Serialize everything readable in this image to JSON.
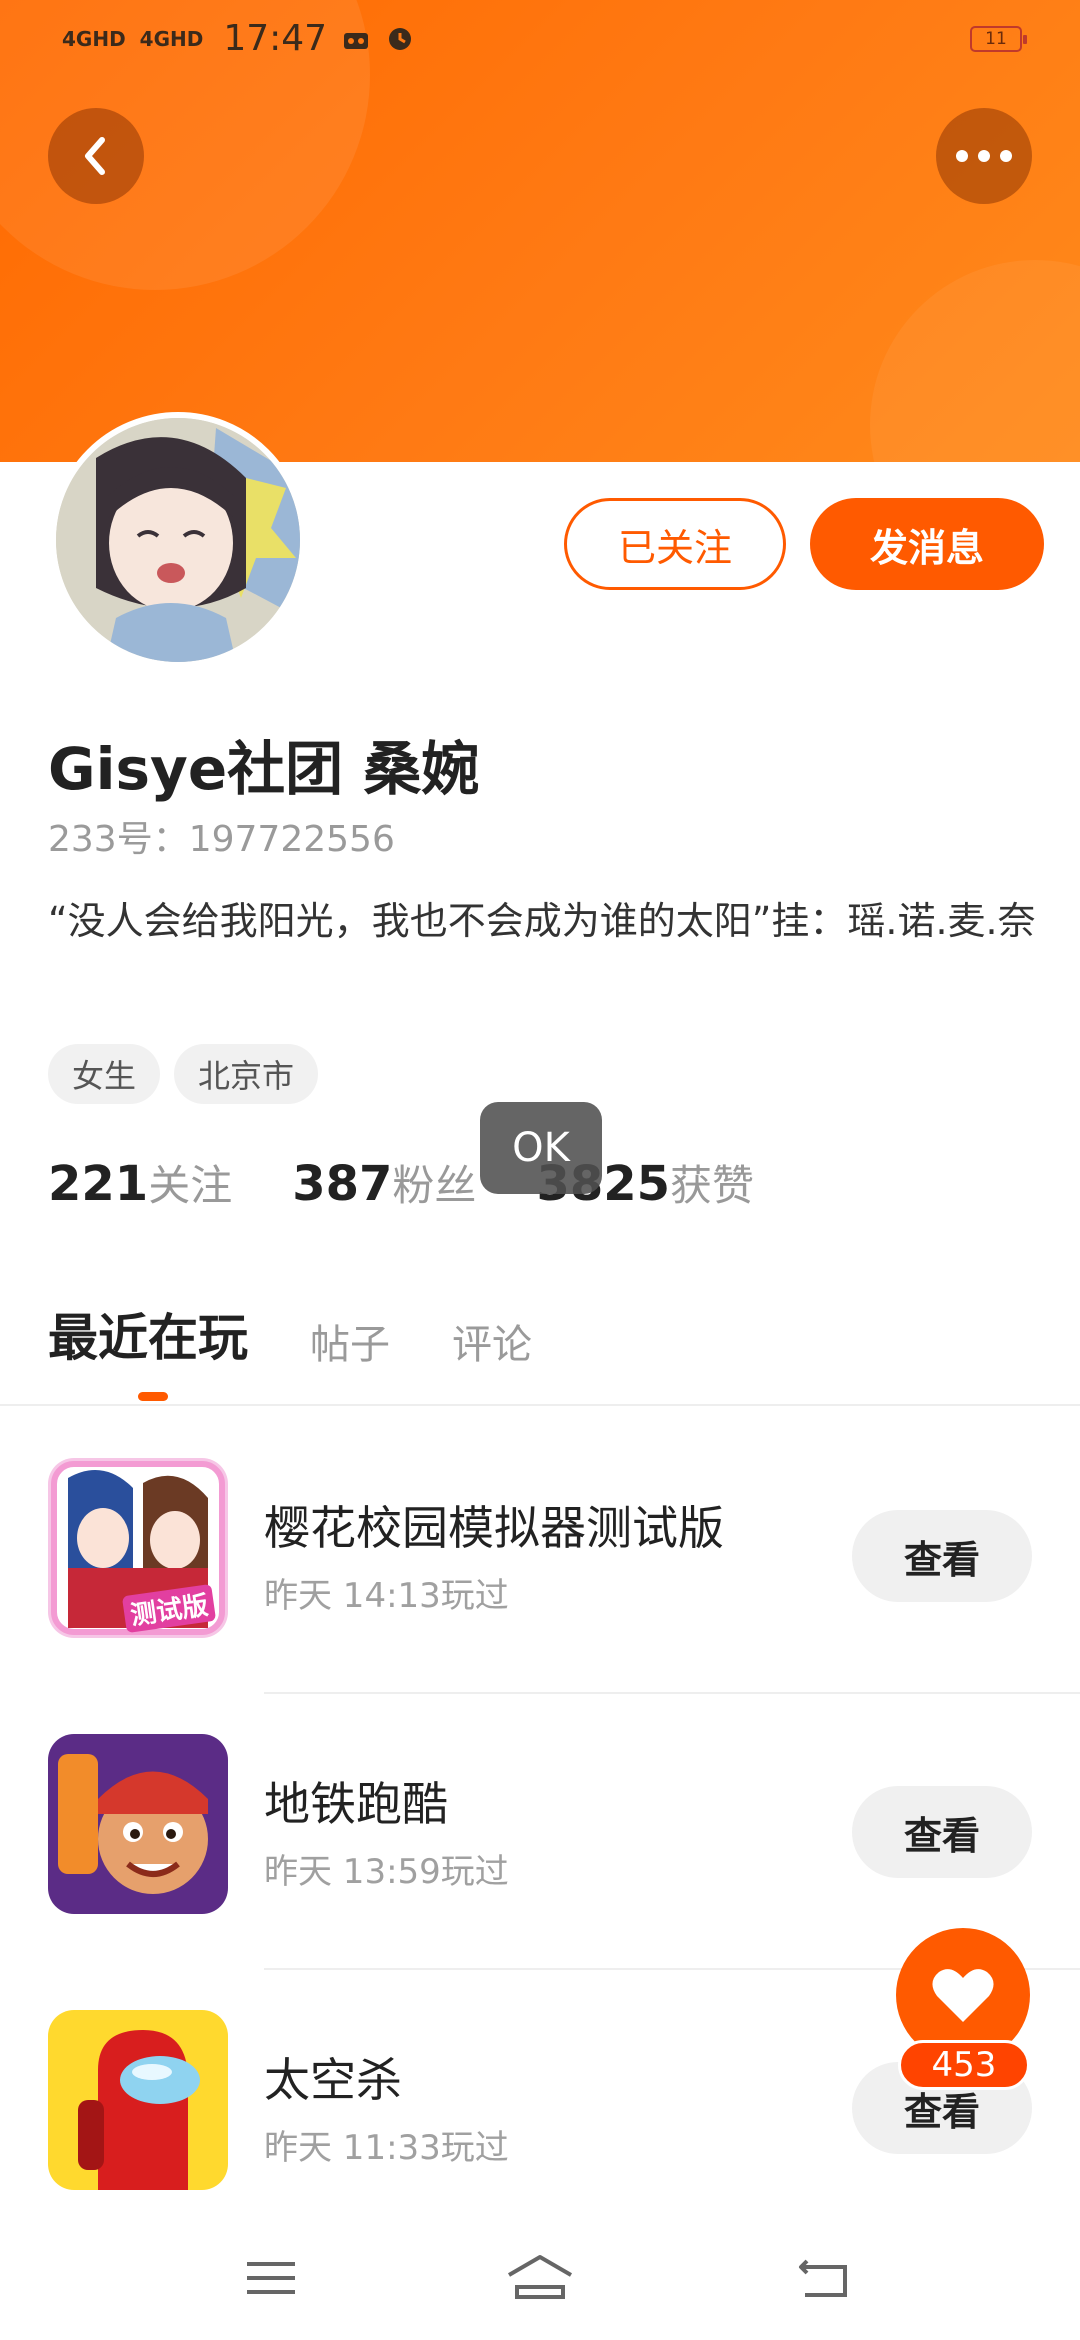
{
  "status_bar": {
    "network1": "4GHD",
    "network2": "4GHD",
    "time": "17:47",
    "battery": "11"
  },
  "colors": {
    "accent": "#ff5a00",
    "banner": "#ff6a00"
  },
  "icons": {
    "back": "chevron-left-icon",
    "more": "more-dots-icon",
    "like": "heart-icon",
    "nav_menu": "menu-icon",
    "nav_home": "home-icon",
    "nav_back": "back-icon"
  },
  "profile": {
    "name": "Gisye社团 桑婉",
    "uid": "233号：197722556",
    "bio": "“没人会给我阳光，我也不会成为谁的太阳”挂：瑶.诺.麦.奈",
    "tags": [
      "女生",
      "北京市"
    ],
    "follow_label": "已关注",
    "message_label": "发消息"
  },
  "stats": [
    {
      "num": "221",
      "label": "关注"
    },
    {
      "num": "387",
      "label": "粉丝"
    },
    {
      "num": "3825",
      "label": "获赞"
    }
  ],
  "toast": "OK",
  "tabs": [
    {
      "label": "最近在玩",
      "active": true
    },
    {
      "label": "帖子",
      "active": false
    },
    {
      "label": "评论",
      "active": false
    }
  ],
  "games": [
    {
      "title": "樱花校园模拟器测试版",
      "time": "昨天 14:13玩过",
      "action": "查看",
      "badge": "测试版"
    },
    {
      "title": "地铁跑酷",
      "time": "昨天 13:59玩过",
      "action": "查看"
    },
    {
      "title": "太空杀",
      "time": "昨天 11:33玩过",
      "action": "查看"
    }
  ],
  "like": {
    "count": "453"
  }
}
